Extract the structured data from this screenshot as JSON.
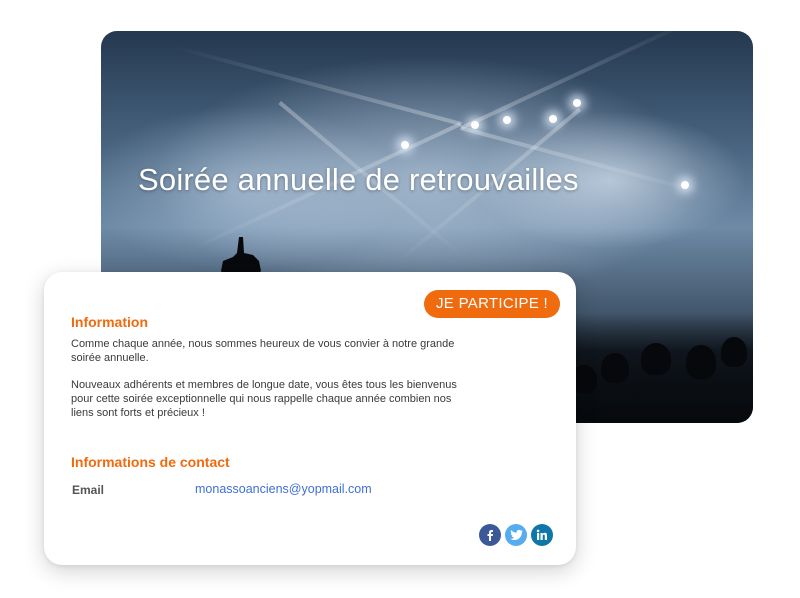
{
  "hero": {
    "title": "Soirée annuelle de retrouvailles"
  },
  "card": {
    "cta_label": "JE PARTICIPE !",
    "info_title": "Information",
    "info_paragraph_1": "Comme chaque année, nous sommes heureux de vous convier à notre grande soirée annuelle.",
    "info_paragraph_2": "Nouveaux adhérents et membres de longue date, vous êtes tous les bienvenus pour cette soirée exceptionnelle qui nous rappelle chaque année combien nos liens sont forts et précieux !",
    "contact_title": "Informations de contact",
    "email_label": "Email",
    "email_value": "monassoanciens@yopmail.com"
  },
  "social": {
    "icons": [
      "facebook-icon",
      "twitter-icon",
      "linkedin-icon"
    ]
  },
  "colors": {
    "accent": "#f06a0e",
    "link": "#3f6fd8",
    "facebook": "#3b5998",
    "twitter": "#55acee",
    "linkedin": "#0e76a8"
  }
}
